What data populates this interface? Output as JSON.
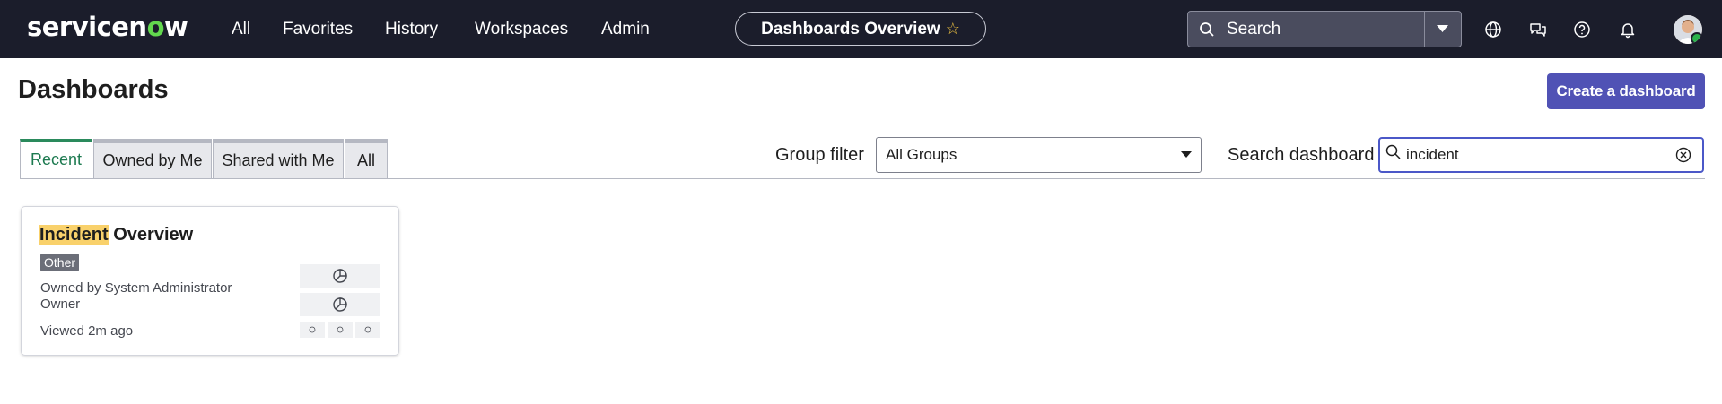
{
  "topbar": {
    "logo_pre": "servicen",
    "logo_o": "o",
    "logo_post": "w",
    "nav": [
      "All",
      "Favorites",
      "History",
      "Workspaces",
      "Admin"
    ],
    "page_pill": "Dashboards Overview",
    "search_placeholder": "Search"
  },
  "page": {
    "title": "Dashboards",
    "create_button": "Create a dashboard"
  },
  "tabs": [
    "Recent",
    "Owned by Me",
    "Shared with Me",
    "All"
  ],
  "active_tab": "Recent",
  "filters": {
    "group_label": "Group filter",
    "group_value": "All Groups",
    "search_label": "Search dashboard",
    "search_value": "incident"
  },
  "cards": [
    {
      "title_highlight": "Incident",
      "title_rest": " Overview",
      "badge": "Other",
      "owned_by": "Owned by System Administrator",
      "role": "Owner",
      "viewed": "Viewed 2m ago"
    }
  ],
  "colors": {
    "topbar_bg": "#1b1d2b",
    "accent_primary": "#5052b5",
    "active_tab": "#2a8a5c",
    "highlight": "#f9d16b",
    "logo_accent": "#62d84e"
  }
}
